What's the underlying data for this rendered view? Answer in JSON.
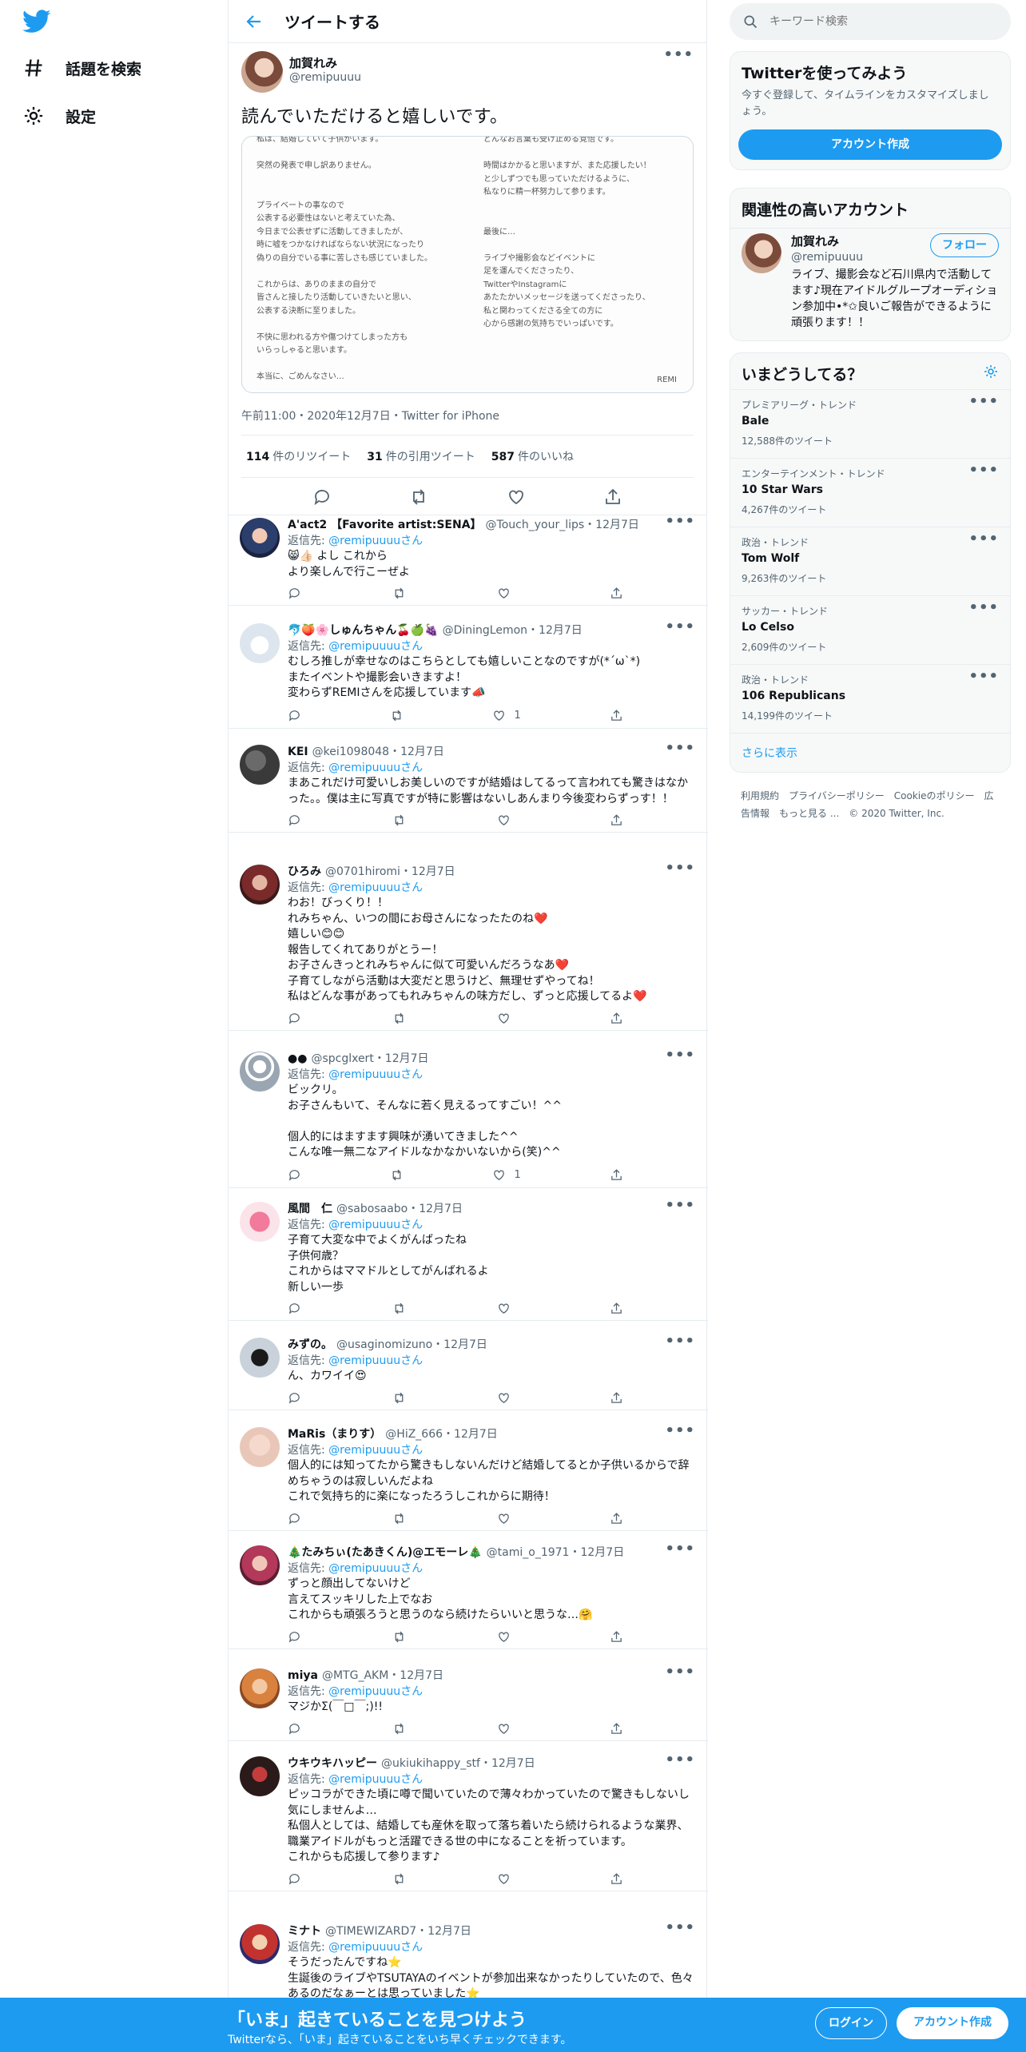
{
  "nav": {
    "explore": "話題を検索",
    "settings": "設定"
  },
  "header": {
    "title": "ツイートする"
  },
  "main_tweet": {
    "name": "加賀れみ",
    "handle": "@remipuuuu",
    "text": "読んでいただけると嬉しいです。",
    "image_left": "私は、結婚していて子供がいます。\n\n突然の発表で申し訳ありません。\n\n\nプライベートの事なので\n公表する必要性はないと考えていた為、\n今日まで公表せずに活動してきましたが、\n時に嘘をつかなければならない状況になったり\n偽りの自分でいる事に苦しさも感じていました。\n\nこれからは、ありのままの自分で\n皆さんと接したり活動していきたいと思い、\n公表する決断に至りました。\n\n不快に思われる方や傷つけてしまった方も\nいらっしゃると思います。\n\n本当に、ごめんなさい…",
    "image_right": "どんなお言葉も受け止める覚悟です。\n\n時間はかかると思いますが、また応援したい！\nと少しずつでも思っていただけるように、\n私なりに精一杯努力して参ります。\n\n\n最後に…\n\nライブや撮影会などイベントに\n足を運んでくださったり、\nTwitterやInstagramに\nあたたかいメッセージを送ってくださったり、\n私と関わってくださる全ての方に\n心から感謝の気持ちでいっぱいです。",
    "image_signature": "REMI",
    "meta": "午前11:00・2020年12月7日・Twitter for iPhone",
    "retweets": "114",
    "retweets_label": "件のリツイート",
    "quotes": "31",
    "quotes_label": "件の引用ツイート",
    "likes": "587",
    "likes_label": "件のいいね"
  },
  "replying_to_prefix": "返信先: ",
  "replying_to_handle": "@remipuuuuさん",
  "replies": [
    {
      "name": "A'act2 【Favorite artist:SENA】",
      "handle": "@Touch_your_lips",
      "date": "・12月7日",
      "text": "😸👍🏻 よし これから\nより楽しんで行こーぜよ",
      "likes": ""
    },
    {
      "name": "🐬🍑🌸しゅんちゃん🍒🍏🍇",
      "handle": "@DiningLemon",
      "date": "・12月7日",
      "text": "むしろ推しが幸せなのはこちらとしても嬉しいことなのですが(*´ω`*)\nまたイベントや撮影会いきますよ！\n変わらずREMIさんを応援しています📣",
      "likes": "1"
    },
    {
      "name": "KEI",
      "handle": "@kei1098048",
      "date": "・12月7日",
      "text": "まあこれだけ可愛いしお美しいのですが結婚はしてるって言われても驚きはなかった。。僕は主に写真ですが特に影響はないしあんまり今後変わらずっす！！",
      "likes": ""
    },
    {
      "name": "ひろみ",
      "handle": "@0701hiromi",
      "date": "・12月7日",
      "text": "わお！びっくり！！\nれみちゃん、いつの間にお母さんになったたのね❤️\n嬉しい😊😊\n報告してくれてありがとうー！\nお子さんきっとれみちゃんに似て可愛いんだろうなあ❤️\n子育てしながら活動は大変だと思うけど、無理せずやってね！\n私はどんな事があってもれみちゃんの味方だし、ずっと応援してるよ❤️",
      "likes": ""
    },
    {
      "name": "●●",
      "handle": "@spcglxert",
      "date": "・12月7日",
      "text": "ビックリ。\nお子さんもいて、そんなに若く見えるってすごい！^^\n\n個人的にはますます興味が湧いてきました^^\nこんな唯一無二なアイドルなかなかいないから(笑)^^",
      "likes": "1"
    },
    {
      "name": "風間　仁",
      "handle": "@sabosaabo",
      "date": "・12月7日",
      "text": "子育て大変な中でよくがんばったね\n子供何歳？\nこれからはママドルとしてがんばれるよ\n新しい一歩",
      "likes": ""
    },
    {
      "name": "みずの。",
      "handle": "@usaginomizuno",
      "date": "・12月7日",
      "text": "ん、カワイイ😍",
      "likes": ""
    },
    {
      "name": "MaRis（まりす）",
      "handle": "@HiZ_666",
      "date": "・12月7日",
      "text": "個人的には知ってたから驚きもしないんだけど結婚してるとか子供いるからで辞めちゃうのは寂しいんだよね\nこれで気持ち的に楽になったろうしこれからに期待！",
      "likes": ""
    },
    {
      "name": "🎄たみちぃ(たあきくん)@エモーレ🎄",
      "handle": "@tami_o_1971",
      "date": "・12月7日",
      "text": "ずっと顔出してないけど\n言えてスッキリした上でなお\nこれからも頑張ろうと思うのなら続けたらいいと思うな…🤗",
      "likes": ""
    },
    {
      "name": "miya",
      "handle": "@MTG_AKM",
      "date": "・12月7日",
      "text": "マジかΣ(￣□￣;)!!",
      "likes": ""
    },
    {
      "name": "ウキウキハッピー",
      "handle": "@ukiukihappy_stf",
      "date": "・12月7日",
      "text": "ピッコラができた頃に噂で聞いていたので薄々わかっていたので驚きもしないし気にしませんよ…\n私個人としては、結婚しても産休を取って落ち着いたら続けられるような業界、職業アイドルがもっと活躍できる世の中になることを祈っています。\nこれからも応援して参ります♪",
      "likes": ""
    },
    {
      "name": "ミナト",
      "handle": "@TIMEWIZARD7",
      "date": "・12月7日",
      "text": "そうだったんですね⭐\n生誕後のライブやTSUTAYAのイベントが参加出来なかったりしていたので、色々あるのだなぁーとは思っていました⭐",
      "likes": ""
    }
  ],
  "search": {
    "placeholder": "キーワード検索"
  },
  "signup": {
    "title": "Twitterを使ってみよう",
    "sub": "今すぐ登録して、タイムラインをカスタマイズしましょう。",
    "button": "アカウント作成"
  },
  "related": {
    "title": "関連性の高いアカウント",
    "name": "加賀れみ",
    "handle": "@remipuuuu",
    "bio": "ライブ、撮影会など石川県内で活動してます♪現在アイドルグループオーディション参加中•*✩良いご報告ができるように頑張ります！！",
    "follow": "フォロー"
  },
  "trends": {
    "title": "いまどうしてる？",
    "items": [
      {
        "cat": "プレミアリーグ・トレンド",
        "name": "Bale",
        "count": "12,588件のツイート"
      },
      {
        "cat": "エンターテインメント・トレンド",
        "name": "10 Star Wars",
        "count": "4,267件のツイート"
      },
      {
        "cat": "政治・トレンド",
        "name": "Tom Wolf",
        "count": "9,263件のツイート"
      },
      {
        "cat": "サッカー・トレンド",
        "name": "Lo Celso",
        "count": "2,609件のツイート"
      },
      {
        "cat": "政治・トレンド",
        "name": "106 Republicans",
        "count": "14,199件のツイート"
      }
    ],
    "show_more": "さらに表示"
  },
  "footer": {
    "links": [
      "利用規約",
      "プライバシーポリシー",
      "Cookieのポリシー",
      "広告情報",
      "もっと見る ..."
    ],
    "copyright": "© 2020 Twitter, Inc."
  },
  "bottom": {
    "title": "「いま」起きていることを見つけよう",
    "sub": "Twitterなら、「いま」起きていることをいち早くチェックできます。",
    "login": "ログイン",
    "signup": "アカウント作成"
  },
  "colors": {
    "accent": "#1d9bf0"
  }
}
